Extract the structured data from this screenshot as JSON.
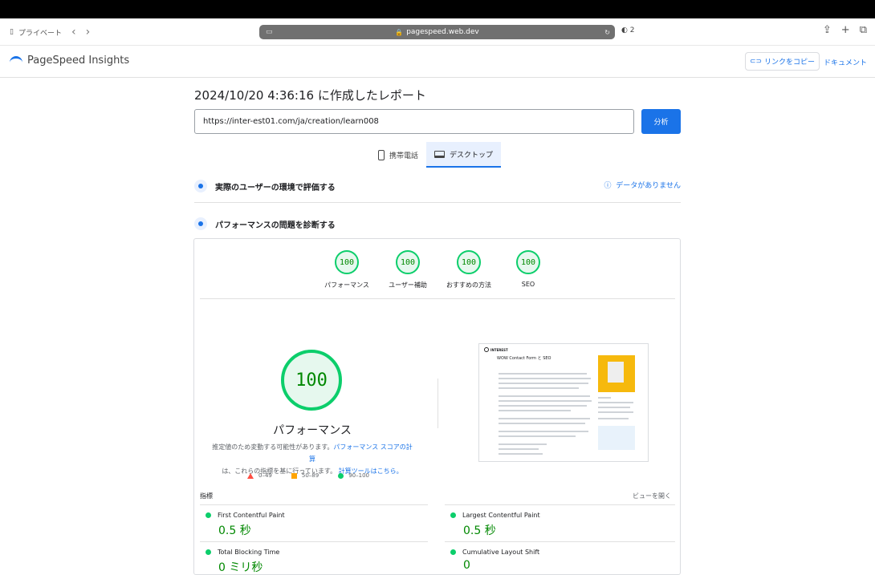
{
  "browser": {
    "private_label": "プライベート",
    "url": "pagespeed.web.dev",
    "tabs_count": "2"
  },
  "header": {
    "logo_text": "PageSpeed Insights",
    "copy_link": "リンクをコピー",
    "docs": "ドキュメント"
  },
  "report": {
    "title": "2024/10/20 4:36:16 に作成したレポート",
    "url_value": "https://inter-est01.com/ja/creation/learn008",
    "analyze_label": "分析"
  },
  "device_tabs": [
    {
      "label": "携帯電話",
      "icon": "phone-icon"
    },
    {
      "label": "デスクトップ",
      "icon": "laptop-icon"
    }
  ],
  "field_section": {
    "title": "実際のユーザーの環境で評価する",
    "no_data": "データがありません"
  },
  "diag_section": {
    "title": "パフォーマンスの問題を診断する"
  },
  "scores": [
    {
      "value": "100",
      "label": "パフォーマンス"
    },
    {
      "value": "100",
      "label": "ユーザー補助"
    },
    {
      "value": "100",
      "label": "おすすめの方法"
    },
    {
      "value": "100",
      "label": "SEO"
    }
  ],
  "main_score": {
    "value": "100",
    "label": "パフォーマンス",
    "desc_1": "推定値のため変動する可能性があります。",
    "desc_link_1": "パフォーマンス スコアの計算",
    "desc_2": "は、これらの指標を基に行っています。",
    "desc_link_2": "計算ツールはこちら。"
  },
  "legend": [
    {
      "range": "0–49",
      "color": "#ff4e42"
    },
    {
      "range": "50–89",
      "color": "#ffa400"
    },
    {
      "range": "90–100",
      "color": "#0cce6b"
    }
  ],
  "preview": {
    "brand": "INTEREST",
    "title": "WOW Contact Form と SEO"
  },
  "metrics": {
    "header": "指標",
    "expand": "ビューを開く",
    "items": [
      {
        "name": "First Contentful Paint",
        "value": "0.5 秒"
      },
      {
        "name": "Largest Contentful Paint",
        "value": "0.5 秒"
      },
      {
        "name": "Total Blocking Time",
        "value": "0 ミリ秒"
      },
      {
        "name": "Cumulative Layout Shift",
        "value": "0"
      }
    ]
  }
}
